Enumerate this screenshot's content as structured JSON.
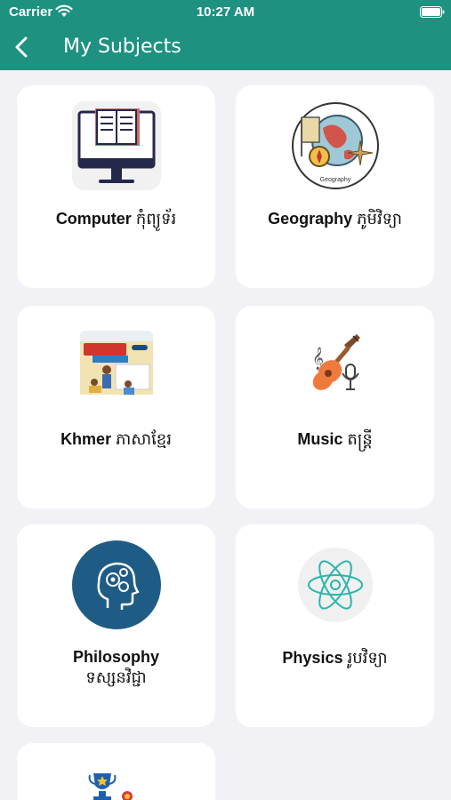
{
  "status_bar": {
    "carrier": "Carrier",
    "time": "10:27 AM"
  },
  "nav": {
    "title": "My Subjects"
  },
  "colors": {
    "header": "#1e9180",
    "background": "#f2f2f6",
    "card": "#ffffff",
    "philosophy_circle": "#1f5c85",
    "physics_atom": "#2bb5ad"
  },
  "subjects": [
    {
      "name": "Computer",
      "khmer": "កុំព្យូទ័រ",
      "icon": "computer-book-icon"
    },
    {
      "name": "Geography",
      "khmer": "ភូមិវិទ្យា",
      "icon": "geography-globe-icon",
      "icon_caption": "Geography"
    },
    {
      "name": "Khmer",
      "khmer": "ភាសាខ្មែរ",
      "icon": "khmer-textbook-icon"
    },
    {
      "name": "Music",
      "khmer": "តន្ត្រី",
      "icon": "guitar-icon"
    },
    {
      "name": "Philosophy",
      "khmer": "ទស្សនវិជ្ជា",
      "icon": "brain-gears-icon"
    },
    {
      "name": "Physics",
      "khmer": "រូបវិទ្យា",
      "icon": "atom-icon"
    },
    {
      "name": "",
      "khmer": "",
      "icon": "trophy-icon"
    }
  ]
}
